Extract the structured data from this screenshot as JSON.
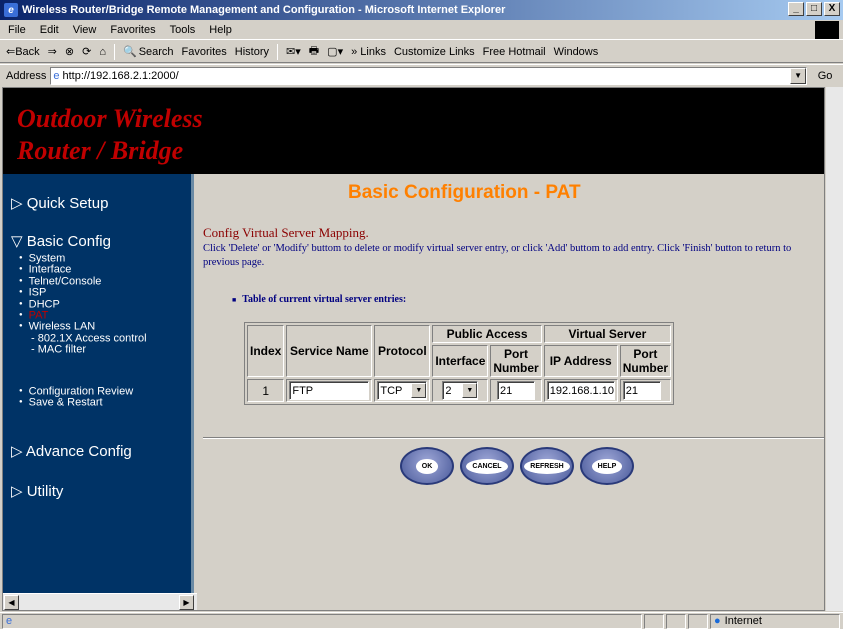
{
  "window": {
    "title": "Wireless Router/Bridge Remote Management and Configuration - Microsoft Internet Explorer",
    "buttons": [
      "_",
      "□",
      "X"
    ]
  },
  "menubar": {
    "items": [
      "File",
      "Edit",
      "View",
      "Favorites",
      "Tools",
      "Help"
    ]
  },
  "toolbar": {
    "back": "⇐Back",
    "forward": "⇒",
    "search": "Search",
    "favorites": "Favorites",
    "history": "History",
    "links": "» Links",
    "customize_links": "Customize Links",
    "free_hotmail": "Free Hotmail",
    "windows": "Windows"
  },
  "address": {
    "label": "Address",
    "url": "http://192.168.2.1:2000/",
    "go": "Go"
  },
  "banner": {
    "line1": "Outdoor Wireless",
    "line2": "Router / Bridge"
  },
  "sidebar": {
    "quick_setup": "▷ Quick Setup",
    "basic_config": "▽ Basic Config",
    "basic_items": [
      "System",
      "Interface",
      "Telnet/Console",
      "ISP",
      "DHCP",
      "PAT",
      "Wireless LAN"
    ],
    "wireless_sub": [
      "- 802.1X Access control",
      "- MAC filter"
    ],
    "extra_items": [
      "Configuration Review",
      "Save & Restart"
    ],
    "advance_config": "▷ Advance Config",
    "utility": "▷ Utility"
  },
  "main": {
    "title": "Basic Configuration - PAT",
    "subtitle": "Config Virtual Server Mapping.",
    "description": "Click 'Delete' or 'Modify' buttom to delete or modify virtual server entry, or click 'Add' buttom to add entry. Click 'Finish' button to return to previous page.",
    "table_label": "Table of current virtual server entries:",
    "table": {
      "headers": {
        "index": "Index",
        "service_name": "Service Name",
        "protocol": "Protocol",
        "public_access": "Public Access",
        "virtual_server": "Virtual Server",
        "interface": "Interface",
        "port_number": "Port Number",
        "ip_address": "IP Address",
        "vport_number": "Port Number"
      },
      "row": {
        "index": "1",
        "service_name": "FTP",
        "protocol": "TCP",
        "interface": "2",
        "port": "21",
        "ip_address": "192.168.1.10",
        "vport": "21"
      }
    },
    "buttons": {
      "ok": "OK",
      "cancel": "CANCEL",
      "refresh": "REFRESH",
      "help": "HELP"
    }
  },
  "status": {
    "zone": "Internet"
  }
}
